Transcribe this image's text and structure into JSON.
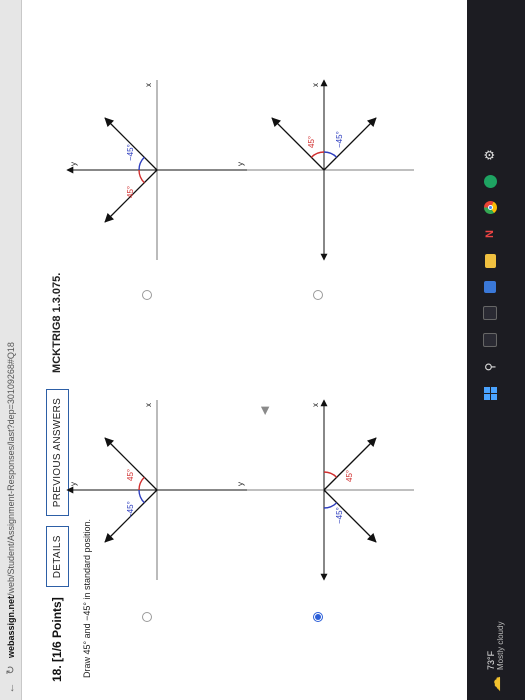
{
  "browser": {
    "url_domain": "webassign.net",
    "url_path": "/web/Student/Assignment-Responses/last?dep=30109268#Q18"
  },
  "question": {
    "number": "18.",
    "points": "[1/6 Points]",
    "details_label": "DETAILS",
    "previous_answers_label": "PREVIOUS ANSWERS",
    "code": "MCKTRIG8 1.3.075.",
    "prompt": "Draw 45° and −45° in standard position."
  },
  "options": [
    {
      "id": "option-1",
      "selected": true,
      "x_label": "x",
      "y_label": "y",
      "angles": [
        {
          "label": "45°",
          "color": "#d12f2f"
        },
        {
          "label": "−45°",
          "color": "#2f3fbf"
        }
      ]
    },
    {
      "id": "option-2",
      "selected": false,
      "x_label": "x",
      "y_label": "y",
      "angles": [
        {
          "label": "45°",
          "color": "#d12f2f"
        },
        {
          "label": "−45°",
          "color": "#2f3fbf"
        }
      ]
    },
    {
      "id": "option-3",
      "selected": false,
      "x_label": "x",
      "y_label": "y",
      "angles": [
        {
          "label": "45°",
          "color": "#d12f2f"
        },
        {
          "label": "−45°",
          "color": "#2f3fbf"
        }
      ]
    },
    {
      "id": "option-4",
      "selected": false,
      "x_label": "x",
      "y_label": "y",
      "angles": [
        {
          "label": "−45°",
          "color": "#2f3fbf"
        },
        {
          "label": "45°",
          "color": "#d12f2f"
        }
      ]
    }
  ],
  "taskbar": {
    "temperature": "73°F",
    "condition": "Mostly cloudy"
  },
  "colors": {
    "accent": "#2b5ed8",
    "positive_angle": "#d12f2f",
    "negative_angle": "#2f3fbf"
  }
}
